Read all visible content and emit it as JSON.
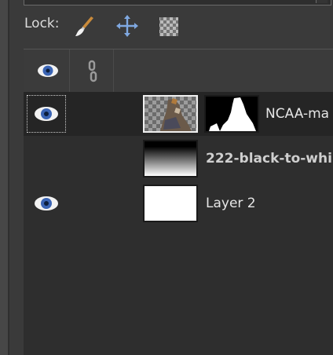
{
  "lock": {
    "label": "Lock:",
    "buttons": [
      {
        "name": "lock-pixels",
        "icon": "paintbrush-icon"
      },
      {
        "name": "lock-position",
        "icon": "move-arrows-icon"
      },
      {
        "name": "lock-alpha",
        "icon": "checkerboard-icon"
      }
    ]
  },
  "columns": {
    "visibility_icon": "eye-icon",
    "link_icon": "chain-icon"
  },
  "layers": [
    {
      "name": "NCAA-ma",
      "visible": true,
      "selected": true,
      "has_mask": true,
      "bold": false
    },
    {
      "name": "222-black-to-whi",
      "visible": false,
      "selected": false,
      "has_mask": false,
      "bold": true
    },
    {
      "name": "Layer 2",
      "visible": true,
      "selected": false,
      "has_mask": false,
      "bold": false
    }
  ],
  "colors": {
    "eye_blue": "#3a64b4",
    "background": "#2e2e2e",
    "selected_row": "#252525"
  }
}
